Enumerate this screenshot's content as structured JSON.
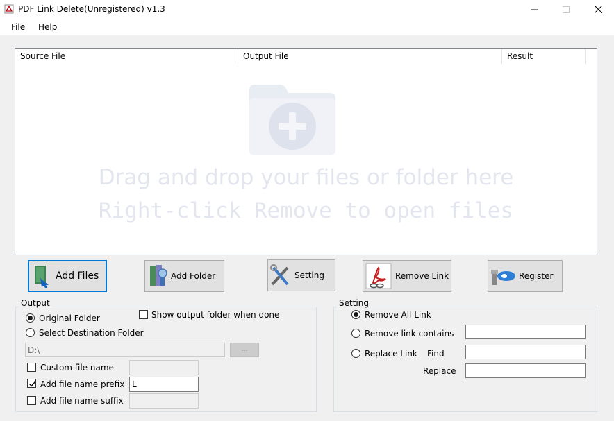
{
  "window": {
    "title": "PDF Link Delete(Unregistered) v1.3"
  },
  "menu": {
    "file": "File",
    "help": "Help"
  },
  "filelist": {
    "columns": [
      "Source File",
      "Output File",
      "Result"
    ],
    "drop_line1": "Drag and drop your files or folder here",
    "drop_line2": "Right-click Remove to open files"
  },
  "toolbar": {
    "add_files": "Add Files",
    "add_folder": "Add Folder",
    "setting": "Setting",
    "remove_link": "Remove Link",
    "register": "Register"
  },
  "output": {
    "title": "Output",
    "original_folder": "Original Folder",
    "select_destination": "Select Destination Folder",
    "show_output": "Show output folder when done",
    "path_value": "D:\\",
    "browse_label": "...",
    "custom_name": "Custom file name",
    "custom_name_value": "",
    "prefix": "Add file name prefix",
    "prefix_value": "L",
    "suffix": "Add file name suffix",
    "suffix_value": ""
  },
  "setting": {
    "title": "Setting",
    "remove_all": "Remove All Link",
    "remove_contains": "Remove link contains",
    "replace_link": "Replace Link",
    "find": "Find",
    "replace": "Replace"
  },
  "colors": {
    "accent_border": "#0078d7",
    "button_bg": "#e1e1e1",
    "window_bg": "#f0f0f0"
  }
}
